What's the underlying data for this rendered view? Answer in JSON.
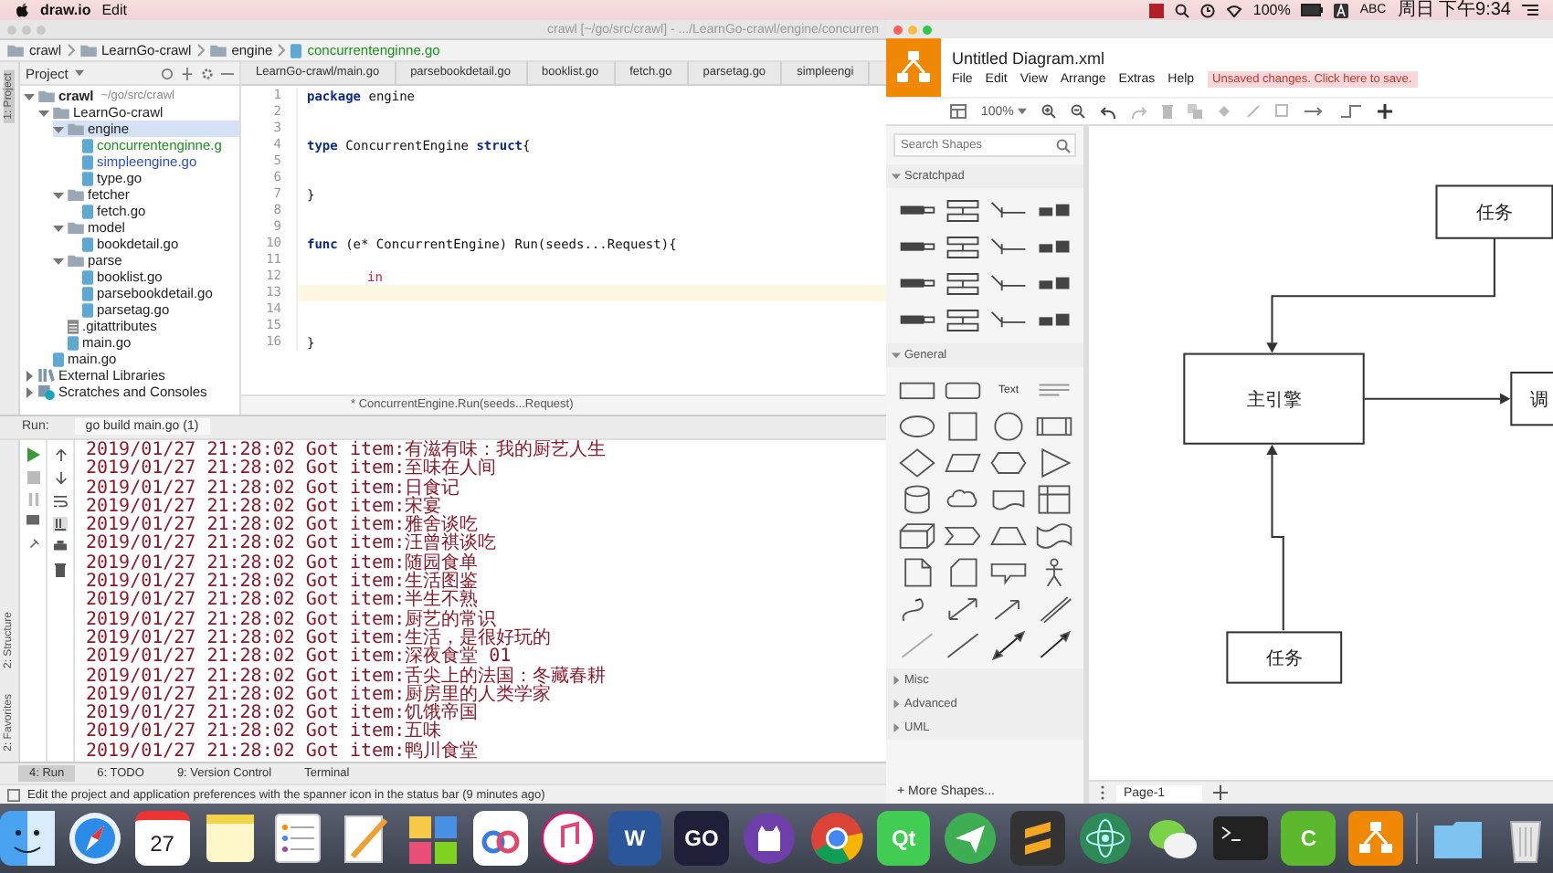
{
  "menubar": {
    "app": "draw.io",
    "menus": [
      "Edit"
    ],
    "battery": "100%",
    "input_source": "ABC",
    "clock": "周日 下午9:34"
  },
  "ide": {
    "title": "crawl [~/go/src/crawl] - .../LearnGo-crawl/engine/concurren",
    "breadcrumbs": [
      {
        "label": "crawl",
        "kind": "folder"
      },
      {
        "label": "LearnGo-crawl",
        "kind": "folder"
      },
      {
        "label": "engine",
        "kind": "folder"
      },
      {
        "label": "concurrentenginne.go",
        "kind": "file"
      }
    ],
    "side_tools_top": [
      {
        "label": "1: Project",
        "selected": true
      }
    ],
    "side_tools_bottom": [
      {
        "label": "2: Structure",
        "selected": false
      },
      {
        "label": "2: Favorites",
        "selected": false
      }
    ],
    "project_panel": {
      "title": "Project",
      "tree": [
        {
          "label": "crawl",
          "hint": "~/go/src/crawl",
          "kind": "folder",
          "expanded": true,
          "selected": false,
          "children": [
            {
              "label": "LearnGo-crawl",
              "kind": "folder",
              "expanded": true,
              "selected": false,
              "children": [
                {
                  "label": "engine",
                  "kind": "folder",
                  "expanded": true,
                  "selected": true,
                  "children": [
                    {
                      "label": "concurrentenginne.g",
                      "kind": "file",
                      "color": "#1d8f1d",
                      "selected": false
                    },
                    {
                      "label": "simpleengine.go",
                      "kind": "file",
                      "color": "#2d4fc4",
                      "selected": false
                    },
                    {
                      "label": "type.go",
                      "kind": "file",
                      "color": "#222222",
                      "selected": false
                    }
                  ]
                },
                {
                  "label": "fetcher",
                  "kind": "folder",
                  "expanded": true,
                  "selected": false,
                  "children": [
                    {
                      "label": "fetch.go",
                      "kind": "file",
                      "color": "#222222",
                      "selected": false
                    }
                  ]
                },
                {
                  "label": "model",
                  "kind": "folder",
                  "expanded": true,
                  "selected": false,
                  "children": [
                    {
                      "label": "bookdetail.go",
                      "kind": "file",
                      "color": "#222222",
                      "selected": false
                    }
                  ]
                },
                {
                  "label": "parse",
                  "kind": "folder",
                  "expanded": true,
                  "selected": false,
                  "children": [
                    {
                      "label": "booklist.go",
                      "kind": "file",
                      "color": "#222222",
                      "selected": false
                    },
                    {
                      "label": "parsebookdetail.go",
                      "kind": "file",
                      "color": "#222222",
                      "selected": false
                    },
                    {
                      "label": "parsetag.go",
                      "kind": "file",
                      "color": "#222222",
                      "selected": false
                    }
                  ]
                },
                {
                  "label": ".gitattributes",
                  "kind": "textfile",
                  "color": "#222222",
                  "selected": false
                },
                {
                  "label": "main.go",
                  "kind": "file",
                  "color": "#222222",
                  "selected": false
                }
              ]
            },
            {
              "label": "main.go",
              "kind": "file",
              "color": "#222222",
              "selected": false
            }
          ]
        },
        {
          "label": "External Libraries",
          "kind": "library",
          "expanded": false,
          "selected": false
        },
        {
          "label": "Scratches and Consoles",
          "kind": "scratch",
          "expanded": false,
          "selected": false
        }
      ]
    },
    "tabs": [
      {
        "label": "LearnGo-crawl/main.go",
        "selected": false
      },
      {
        "label": "parsebookdetail.go",
        "selected": false
      },
      {
        "label": "booklist.go",
        "selected": false
      },
      {
        "label": "fetch.go",
        "selected": false
      },
      {
        "label": "parsetag.go",
        "selected": false
      },
      {
        "label": "simpleengi",
        "selected": false
      }
    ],
    "code_lines": [
      {
        "number": "1",
        "current": false,
        "tokens": [
          {
            "kind": "keyword",
            "text": "package"
          },
          {
            "kind": "plain",
            "text": " engine"
          }
        ]
      },
      {
        "number": "2",
        "current": false
      },
      {
        "number": "3",
        "current": false
      },
      {
        "number": "4",
        "current": false,
        "tokens": [
          {
            "kind": "keyword",
            "text": "type"
          },
          {
            "kind": "plain",
            "text": " ConcurrentEngine "
          },
          {
            "kind": "keyword",
            "text": "struct"
          },
          {
            "kind": "plain",
            "text": "{"
          }
        ]
      },
      {
        "number": "5",
        "current": false
      },
      {
        "number": "6",
        "current": false
      },
      {
        "number": "7",
        "current": false,
        "tokens": [
          {
            "kind": "plain",
            "text": "}"
          }
        ]
      },
      {
        "number": "8",
        "current": false
      },
      {
        "number": "9",
        "current": false
      },
      {
        "number": "10",
        "current": false,
        "tokens": [
          {
            "kind": "keyword",
            "text": "func"
          },
          {
            "kind": "plain",
            "text": " (e* ConcurrentEngine) Run(seeds...Request){"
          }
        ]
      },
      {
        "number": "11",
        "current": false
      },
      {
        "number": "12",
        "current": false,
        "indented": true,
        "tokens": [
          {
            "kind": "error",
            "text": "in"
          }
        ]
      },
      {
        "number": "13",
        "current": true
      },
      {
        "number": "14",
        "current": false
      },
      {
        "number": "15",
        "current": false
      },
      {
        "number": "16",
        "current": false,
        "tokens": [
          {
            "kind": "plain",
            "text": "}"
          }
        ]
      }
    ],
    "code_breadcrumb": "* ConcurrentEngine.Run(seeds...Request)",
    "run_panel": {
      "label": "Run:",
      "tab": "go build main.go (1)",
      "log": [
        "2019/01/27 21:28:02 Got item:有滋有味：我的厨艺人生",
        "2019/01/27 21:28:02 Got item:至味在人间",
        "2019/01/27 21:28:02 Got item:日食记",
        "2019/01/27 21:28:02 Got item:宋宴",
        "2019/01/27 21:28:02 Got item:雅舍谈吃",
        "2019/01/27 21:28:02 Got item:汪曾祺谈吃",
        "2019/01/27 21:28:02 Got item:随园食单",
        "2019/01/27 21:28:02 Got item:生活图鉴",
        "2019/01/27 21:28:02 Got item:半生不熟",
        "2019/01/27 21:28:02 Got item:厨艺的常识",
        "2019/01/27 21:28:02 Got item:生活，是很好玩的",
        "2019/01/27 21:28:02 Got item:深夜食堂 01",
        "2019/01/27 21:28:02 Got item:舌尖上的法国：冬藏春耕",
        "2019/01/27 21:28:02 Got item:厨房里的人类学家",
        "2019/01/27 21:28:02 Got item:饥饿帝国",
        "2019/01/27 21:28:02 Got item:五味",
        "2019/01/27 21:28:02 Got item:鸭川食堂"
      ]
    },
    "tool_tabs": [
      {
        "label": "4: Run",
        "selected": true
      },
      {
        "label": "6: TODO",
        "selected": false
      },
      {
        "label": "9: Version Control",
        "selected": false
      },
      {
        "label": "Terminal",
        "selected": false
      }
    ],
    "status_bar": "Edit the project and application preferences with the spanner icon in the status bar (9 minutes ago)"
  },
  "drawio": {
    "title": "Untitled Diagram.xml",
    "menus": [
      "File",
      "Edit",
      "View",
      "Arrange",
      "Extras",
      "Help"
    ],
    "unsaved_notice": "Unsaved changes. Click here to save.",
    "zoom": "100%",
    "search": {
      "placeholder": "Search Shapes"
    },
    "sections": [
      {
        "title": "Scratchpad",
        "kind": "scratchpad",
        "expanded": true
      },
      {
        "title": "General",
        "kind": "general",
        "expanded": true,
        "text_shape": "Text"
      },
      {
        "title": "Misc",
        "expanded": false
      },
      {
        "title": "Advanced",
        "expanded": false
      },
      {
        "title": "UML",
        "expanded": false
      }
    ],
    "more_shapes": "+ More Shapes...",
    "pages": [
      {
        "label": "Page-1",
        "selected": true
      }
    ],
    "diagram": {
      "nodes": [
        {
          "label": "任务"
        },
        {
          "label": "主引擎"
        },
        {
          "label": "任务"
        },
        {
          "label": "调"
        }
      ]
    }
  },
  "dock": [
    {
      "kind": "finder"
    },
    {
      "kind": "compass"
    },
    {
      "kind": "calendar",
      "label": "27"
    },
    {
      "kind": "notepad"
    },
    {
      "kind": "checklist"
    },
    {
      "kind": "pen"
    },
    {
      "kind": "tiles"
    },
    {
      "kind": "cloud"
    },
    {
      "kind": "music"
    },
    {
      "kind": "letter",
      "label": "W",
      "color": "#2b579a"
    },
    {
      "kind": "letter",
      "label": "GO",
      "color": "#1f1f3a"
    },
    {
      "kind": "cat"
    },
    {
      "kind": "chrome"
    },
    {
      "kind": "letter",
      "label": "Qt",
      "color": "#41cd52"
    },
    {
      "kind": "plane"
    },
    {
      "kind": "sublime"
    },
    {
      "kind": "atom"
    },
    {
      "kind": "chat"
    },
    {
      "kind": "terminal"
    },
    {
      "kind": "letter",
      "label": "C",
      "color": "#5cb82c"
    },
    {
      "kind": "flowchart"
    },
    {
      "kind": "separator"
    },
    {
      "kind": "folder"
    },
    {
      "kind": "trash"
    }
  ]
}
